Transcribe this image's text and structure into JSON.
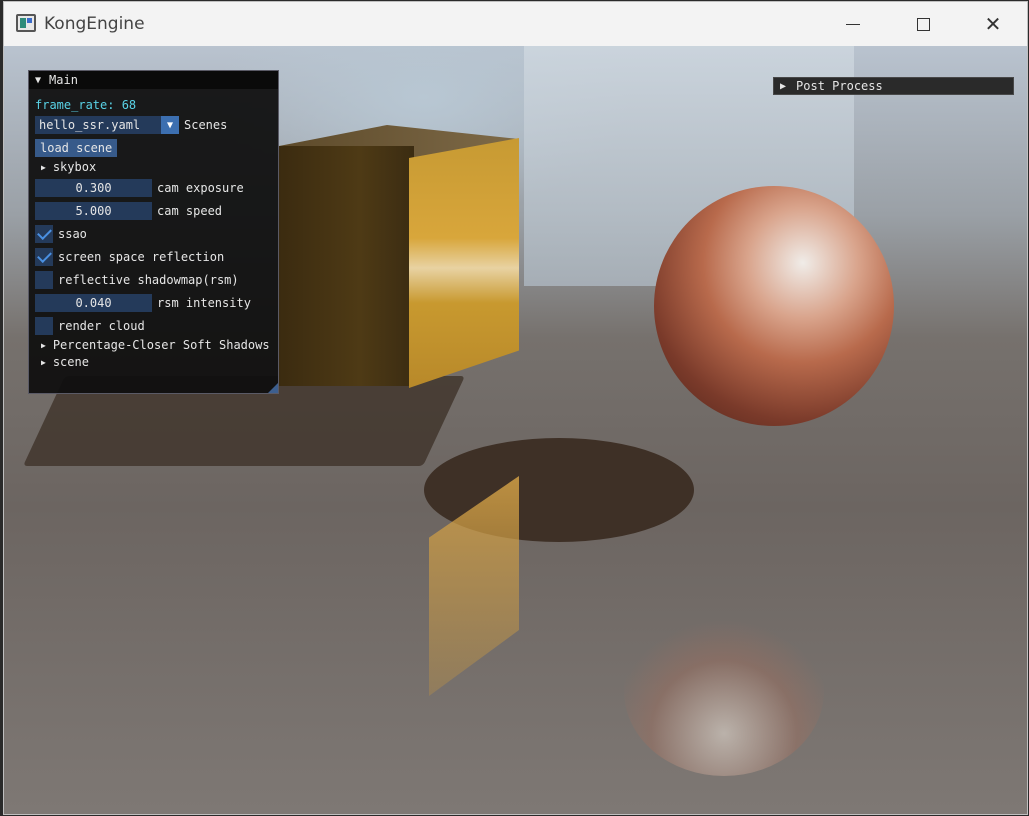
{
  "window": {
    "title": "KongEngine"
  },
  "main_panel": {
    "header": "Main",
    "frame_rate": "frame_rate: 68",
    "scene_combo": {
      "value": "hello_ssr.yaml",
      "label": "Scenes"
    },
    "load_button": "load scene",
    "skybox": "skybox",
    "cam_exposure": {
      "value": "0.300",
      "label": "cam exposure"
    },
    "cam_speed": {
      "value": "5.000",
      "label": "cam speed"
    },
    "ssao": {
      "label": "ssao",
      "checked": true
    },
    "ssr": {
      "label": "screen space reflection",
      "checked": true
    },
    "rsm": {
      "label": "reflective shadowmap(rsm)",
      "checked": false
    },
    "rsm_intensity": {
      "value": "0.040",
      "label": "rsm intensity"
    },
    "render_cloud": {
      "label": "render cloud",
      "checked": false
    },
    "pcss": "Percentage-Closer Soft Shadows",
    "scene": "scene"
  },
  "post_panel": {
    "header": "Post Process"
  },
  "colors": {
    "panel_bg": "#0f0f0f",
    "frame_bg": "#243a5a",
    "button": "#375a8a",
    "check": "#4a90e2",
    "fps_text": "#59d2e6"
  },
  "icons": [
    "app-icon",
    "minimize-icon",
    "maximize-icon",
    "close-icon",
    "collapse-arrow-icon",
    "expand-arrow-icon",
    "dropdown-arrow-icon",
    "checkmark-icon",
    "resize-grip-icon"
  ]
}
